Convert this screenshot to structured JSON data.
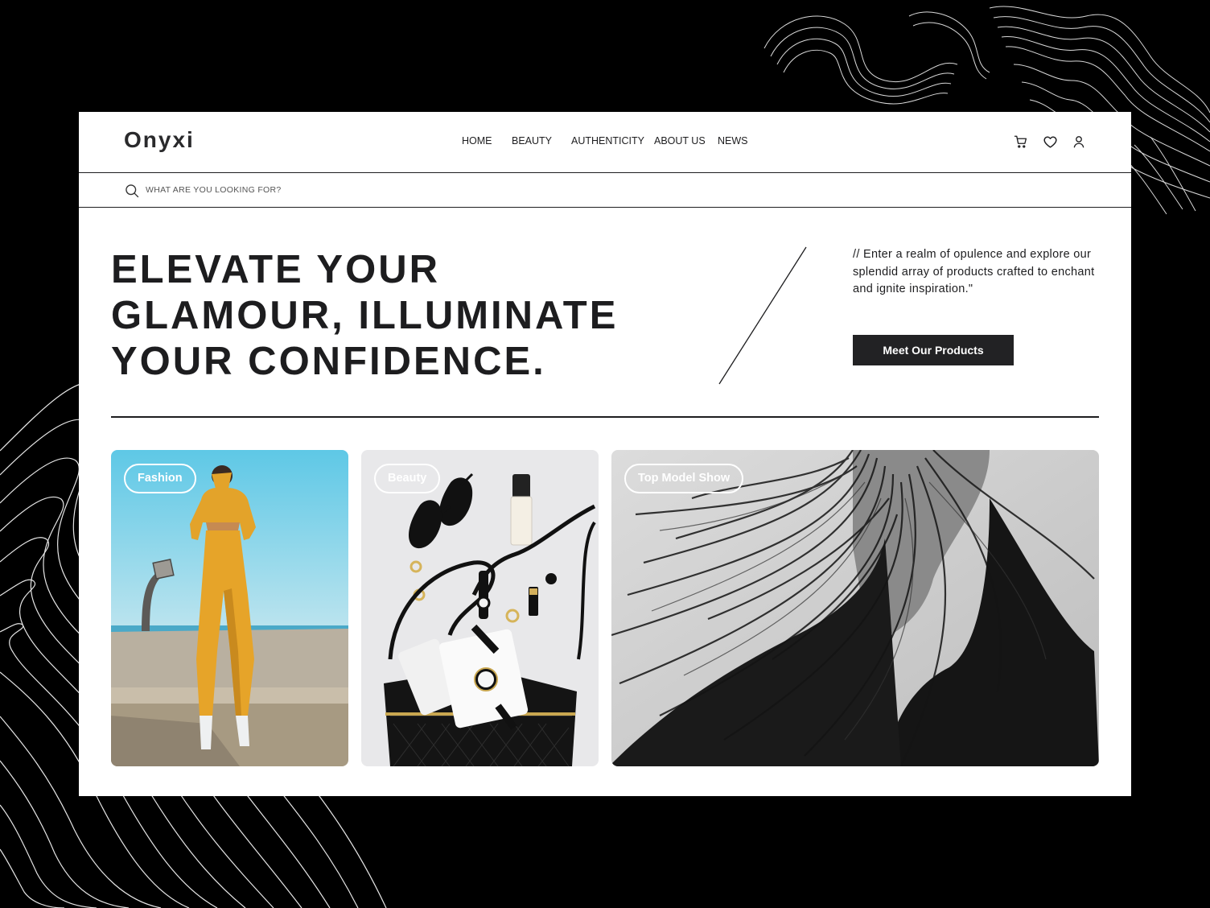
{
  "brand": {
    "logo": "Onyxi"
  },
  "nav": {
    "items": [
      "HOME",
      "BEAUTY",
      "AUTHENTICITY",
      "ABOUT US",
      "NEWS"
    ]
  },
  "header_icons": [
    "cart-icon",
    "heart-icon",
    "user-icon"
  ],
  "search": {
    "placeholder": "WHAT ARE YOU LOOKING FOR?"
  },
  "hero": {
    "title_lines": [
      "ELEVATE  YOUR",
      "GLAMOUR,  ILLUMINATE",
      "YOUR  CONFIDENCE."
    ],
    "description": "// Enter a realm of opulence and explore our splendid array of products crafted to enchant and ignite inspiration.\"",
    "cta_label": "Meet Our Products"
  },
  "cards": [
    {
      "label": "Fashion"
    },
    {
      "label": "Beauty"
    },
    {
      "label": "Top Model Show"
    }
  ],
  "colors": {
    "page_bg": "#000000",
    "panel_bg": "#ffffff",
    "text": "#1d1d1f",
    "button_bg": "#222224",
    "button_text": "#ffffff"
  }
}
